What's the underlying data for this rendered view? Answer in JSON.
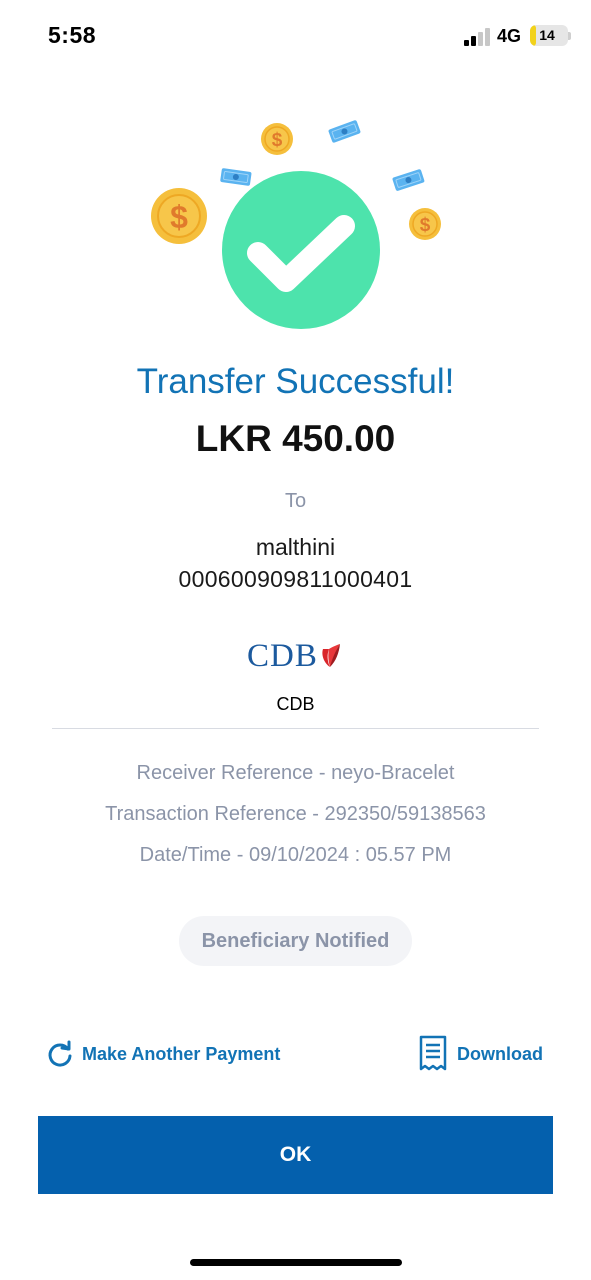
{
  "status_bar": {
    "time": "5:58",
    "network": "4G",
    "battery": "14",
    "battery_level": 0.14
  },
  "hero": {
    "icons": [
      "checkmark-icon",
      "coin-icon",
      "banknote-icon"
    ],
    "colors": {
      "check_circle": "#4de3ac",
      "coin": "#f5bf3c",
      "banknote": "#5ab3f0"
    }
  },
  "result": {
    "title": "Transfer Successful!",
    "amount": "LKR 450.00"
  },
  "recipient": {
    "to_label": "To",
    "name": "malthini",
    "account": "000600909811000401"
  },
  "bank": {
    "logo_text": "CDB",
    "name": "CDB"
  },
  "details": {
    "receiver_reference_label": "Receiver Reference - ",
    "receiver_reference": "neyo-Bracelet",
    "transaction_reference_label": "Transaction Reference - ",
    "transaction_reference": "292350/59138563",
    "datetime_label": "Date/Time - ",
    "datetime": "09/10/2024 : 05.57 PM"
  },
  "badge": "Beneficiary Notified",
  "actions": {
    "another_payment": "Make Another Payment",
    "download": "Download"
  },
  "ok_button": "OK",
  "colors": {
    "accent": "#1273b5",
    "primary_button": "#0460ad",
    "muted_text": "#8b94a8"
  }
}
